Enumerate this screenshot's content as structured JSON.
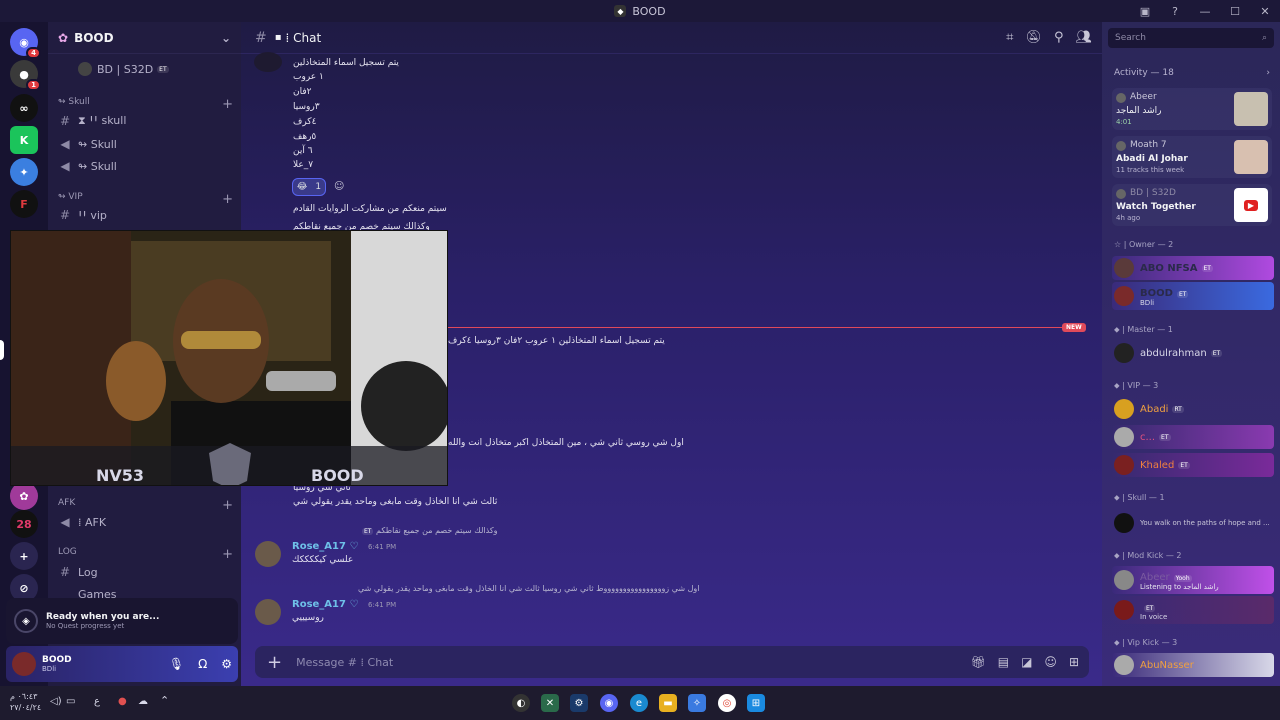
{
  "window": {
    "title": "BOOD"
  },
  "server": {
    "name": "BOOD",
    "voice_user": "BD | S32D",
    "voice_user_tag": "ET"
  },
  "categories": {
    "skull": {
      "label": "↬ Skull",
      "channels": [
        "⧗ ꞋꞋ skull",
        "↬ Skull",
        "↬ Skull"
      ]
    },
    "vip": {
      "label": "↬ VIP",
      "channels": [
        "ꞋꞋ vip"
      ]
    },
    "afk": {
      "label": "AFK",
      "channels": [
        "⁞ AFK"
      ]
    },
    "log": {
      "label": "LOG",
      "channels": [
        "Log",
        "Games"
      ]
    }
  },
  "quest": {
    "title": "Ready when you are...",
    "subtitle": "No Quest progress yet"
  },
  "user": {
    "name": "BOOD",
    "status": "BD‌li"
  },
  "channel": {
    "name": "⁞ Chat"
  },
  "messages": {
    "top_line": "يتم تسجيل اسماء المتخاذلين",
    "list": [
      "١ عروب",
      "٢فان",
      "٣روسيا",
      "٤كرف",
      "٥رهف",
      "٦ آين",
      "٧_علا"
    ],
    "reaction_count": "1",
    "line2": "سيتم منعكم من مشاركت الروايات القادم",
    "line3": "وكذالك سيتم خصم من جميع نقاطكم",
    "preview": "يتم تسجيل اسماء المتخاذلين  ١ عروب  ٢فان  ٣روسيا ٤كرف",
    "reply1": "اول شي روسي ثاني شي ، مين المتخاذل اكبر متخاذل انت والله",
    "line_a": "ثاني شي روسيا",
    "line_b": "ثالث شي انا الخاذل وقت مابغى وماحد يقدر يقولي شي",
    "reply2": "وكذالك سيتم خصم من جميع نقاطكم",
    "author1": "Rose_A17",
    "time1": "6:41 PM",
    "text1": "علسي كيككككك",
    "reply3": "اول شي زووووووووووووووووط ثاني شي روسيا  ثالث شي انا الخاذل وقت مابغى وماحد يقدر يقولي شي",
    "author2": "Rose_A17",
    "time2": "6:41 PM",
    "text2": "روسيييي",
    "new_label": "NEW",
    "composer_placeholder": "Message # ⁞ Chat",
    "tag": "ET"
  },
  "overlay_video": {
    "left_text": "NV53",
    "right_text": "BOOD"
  },
  "sidebar_right": {
    "search_placeholder": "Search",
    "activity_header": "Activity — 18",
    "activities": [
      {
        "user": "Abeer",
        "title": "راشد الماجد",
        "sub": "4:01"
      },
      {
        "user": "Moath 7",
        "title": "Abadi Al Johar",
        "sub": "11 tracks this week"
      },
      {
        "user": "BD | S32D",
        "title": "Watch Together",
        "sub": "4h ago"
      }
    ],
    "groups": [
      {
        "label": "☆ | Owner — 2"
      },
      {
        "label": "⬥ | Master — 1"
      },
      {
        "label": "⬥ | VIP — 3"
      },
      {
        "label": "⬥ | Skull — 1"
      },
      {
        "label": "⬥ | Mod Kick — 2"
      },
      {
        "label": "⬥ | Vip Kick — 3"
      }
    ],
    "members": {
      "abo": "ABO NFSA",
      "bood": "BOOD",
      "bood_status": "BD‌li",
      "abdul": "abdulrahman",
      "abadi": "Abadi",
      "c": "c...",
      "khaled": "Khaled",
      "skull_status": "You walk on the paths of hope and ...",
      "abeer": "Abeer",
      "abeer_sub": "Listening to راشد الماجد",
      "abeer_tag": "Yooh",
      "invoice": "In voice",
      "abu": "AbuNasser"
    }
  },
  "tags": {
    "et": "ET",
    "rt": "RT"
  },
  "taskbar": {
    "time": "٠٦:٤٣ م",
    "date": "٢٧/٠٤/٢٤",
    "lang": "ع"
  },
  "colors": {
    "accent": "#5865f2",
    "new": "#e04a5a",
    "online": "#23a55a"
  }
}
